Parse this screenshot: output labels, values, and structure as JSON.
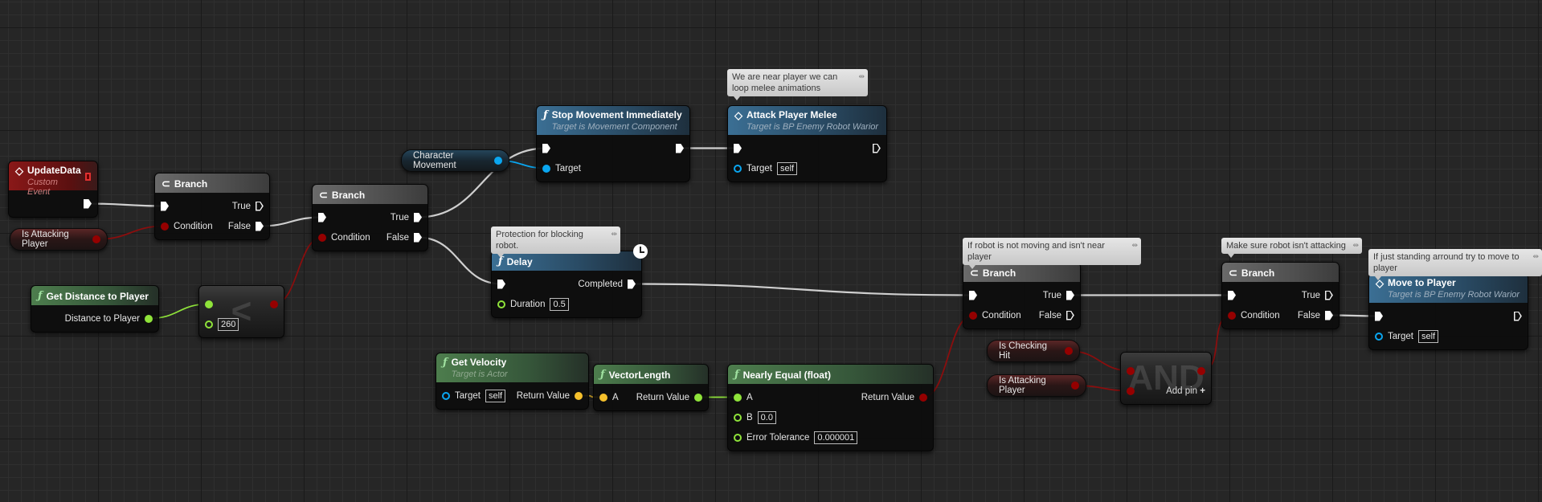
{
  "colors": {
    "exec": "#ffffff",
    "bool": "#950000",
    "float": "#8fe33a",
    "object": "#0aa6f0",
    "vector": "#f5c02c"
  },
  "nodes": [
    {
      "id": "update_data",
      "type": "event",
      "icon": "event-diamond-icon",
      "title": "UpdateData",
      "subtitle": "Custom Event",
      "inputs": [],
      "outputs": [
        {
          "kind": "exec",
          "label": ""
        }
      ]
    },
    {
      "id": "branch1",
      "type": "branch",
      "icon": "branch-icon",
      "title": "Branch",
      "inputs": [
        {
          "kind": "exec",
          "label": ""
        },
        {
          "kind": "bool",
          "label": "Condition"
        }
      ],
      "outputs": [
        {
          "kind": "exec",
          "label": "True",
          "hollow": true
        },
        {
          "kind": "exec",
          "label": "False"
        }
      ]
    },
    {
      "id": "is_attacking_1",
      "type": "var",
      "vartype": "bool",
      "title": "Is Attacking Player"
    },
    {
      "id": "get_distance",
      "type": "pure",
      "icon": "function-icon",
      "title": "Get Distance to Player",
      "inputs": [],
      "outputs": [
        {
          "kind": "float",
          "label": "Distance to Player"
        }
      ]
    },
    {
      "id": "compare",
      "type": "op",
      "symbol": "<",
      "inputs": [
        {
          "kind": "float",
          "label": ""
        },
        {
          "kind": "float",
          "label": "",
          "value": "260",
          "hollow": true
        }
      ],
      "outputs": [
        {
          "kind": "bool",
          "label": ""
        }
      ]
    },
    {
      "id": "branch2",
      "type": "branch",
      "icon": "branch-icon",
      "title": "Branch",
      "inputs": [
        {
          "kind": "exec",
          "label": ""
        },
        {
          "kind": "bool",
          "label": "Condition"
        }
      ],
      "outputs": [
        {
          "kind": "exec",
          "label": "True"
        },
        {
          "kind": "exec",
          "label": "False"
        }
      ]
    },
    {
      "id": "char_movement",
      "type": "var",
      "vartype": "object",
      "title": "Character Movement"
    },
    {
      "id": "stop_movement",
      "type": "function",
      "icon": "function-icon",
      "title": "Stop Movement Immediately",
      "subtitle": "Target is Movement Component",
      "inputs": [
        {
          "kind": "exec",
          "label": ""
        },
        {
          "kind": "object",
          "label": "Target"
        }
      ],
      "outputs": [
        {
          "kind": "exec",
          "label": ""
        }
      ]
    },
    {
      "id": "attack_melee",
      "type": "function",
      "icon": "event-diamond-icon",
      "title": "Attack Player Melee",
      "subtitle": "Target is BP Enemy Robot Warior",
      "inputs": [
        {
          "kind": "exec",
          "label": ""
        },
        {
          "kind": "object",
          "label": "Target",
          "value": "self",
          "hollow": true
        }
      ],
      "outputs": [
        {
          "kind": "exec",
          "label": "",
          "hollow": true
        }
      ]
    },
    {
      "id": "delay",
      "type": "function",
      "icon": "function-icon",
      "title": "Delay",
      "latent": true,
      "inputs": [
        {
          "kind": "exec",
          "label": ""
        },
        {
          "kind": "float",
          "label": "Duration",
          "value": "0.5",
          "hollow": true
        }
      ],
      "outputs": [
        {
          "kind": "exec",
          "label": "Completed"
        }
      ]
    },
    {
      "id": "branch3",
      "type": "branch",
      "icon": "branch-icon",
      "title": "Branch",
      "inputs": [
        {
          "kind": "exec",
          "label": ""
        },
        {
          "kind": "bool",
          "label": "Condition"
        }
      ],
      "outputs": [
        {
          "kind": "exec",
          "label": "True"
        },
        {
          "kind": "exec",
          "label": "False",
          "hollow": true
        }
      ]
    },
    {
      "id": "branch4",
      "type": "branch",
      "icon": "branch-icon",
      "title": "Branch",
      "inputs": [
        {
          "kind": "exec",
          "label": ""
        },
        {
          "kind": "bool",
          "label": "Condition"
        }
      ],
      "outputs": [
        {
          "kind": "exec",
          "label": "True",
          "hollow": true
        },
        {
          "kind": "exec",
          "label": "False"
        }
      ]
    },
    {
      "id": "move_to_player",
      "type": "function",
      "icon": "event-diamond-icon",
      "title": "Move to Player",
      "subtitle": "Target is BP Enemy Robot Warior",
      "inputs": [
        {
          "kind": "exec",
          "label": ""
        },
        {
          "kind": "object",
          "label": "Target",
          "value": "self",
          "hollow": true
        }
      ],
      "outputs": [
        {
          "kind": "exec",
          "label": "",
          "hollow": true
        }
      ]
    },
    {
      "id": "is_checking_hit",
      "type": "var",
      "vartype": "bool",
      "title": "Is Checking Hit"
    },
    {
      "id": "is_attacking_2",
      "type": "var",
      "vartype": "bool",
      "title": "Is Attacking Player"
    },
    {
      "id": "and",
      "type": "op",
      "symbol": "AND",
      "add_pin": "Add pin",
      "inputs": [
        {
          "kind": "bool",
          "label": ""
        },
        {
          "kind": "bool",
          "label": ""
        }
      ],
      "outputs": [
        {
          "kind": "bool",
          "label": ""
        }
      ]
    },
    {
      "id": "get_velocity",
      "type": "pure",
      "icon": "function-icon",
      "title": "Get Velocity",
      "subtitle": "Target is Actor",
      "inputs": [
        {
          "kind": "object",
          "label": "Target",
          "value": "self",
          "hollow": true
        }
      ],
      "outputs": [
        {
          "kind": "vector",
          "label": "Return Value"
        }
      ]
    },
    {
      "id": "vector_length",
      "type": "pure",
      "icon": "function-icon",
      "title": "VectorLength",
      "inputs": [
        {
          "kind": "vector",
          "label": "A"
        }
      ],
      "outputs": [
        {
          "kind": "float",
          "label": "Return Value"
        }
      ]
    },
    {
      "id": "nearly_equal",
      "type": "pure",
      "icon": "function-icon",
      "title": "Nearly Equal (float)",
      "inputs": [
        {
          "kind": "float",
          "label": "A"
        },
        {
          "kind": "float",
          "label": "B",
          "value": "0.0",
          "hollow": true
        },
        {
          "kind": "float",
          "label": "Error Tolerance",
          "value": "0.000001",
          "hollow": true
        }
      ],
      "outputs": [
        {
          "kind": "bool",
          "label": "Return Value"
        }
      ]
    }
  ],
  "comments": [
    {
      "id": "c_melee",
      "text": "We are near player we can loop melee animations"
    },
    {
      "id": "c_protection",
      "text": "Protection for blocking robot."
    },
    {
      "id": "c_not_moving",
      "text": "If robot is not moving and isn't near player"
    },
    {
      "id": "c_not_attacking",
      "text": "Make sure robot isn't attacking"
    },
    {
      "id": "c_move",
      "text": "If just standing arround try to move to player"
    }
  ],
  "links": [
    [
      "update_data",
      "o0",
      "branch1",
      "i0",
      "exec"
    ],
    [
      "is_attacking_1",
      "o0",
      "branch1",
      "i1",
      "bool"
    ],
    [
      "branch1",
      "o1",
      "branch2",
      "i0",
      "exec"
    ],
    [
      "get_distance",
      "o0",
      "compare",
      "i0",
      "float"
    ],
    [
      "compare",
      "o0",
      "branch2",
      "i1",
      "bool"
    ],
    [
      "branch2",
      "o0",
      "stop_movement",
      "i0",
      "exec"
    ],
    [
      "char_movement",
      "o0",
      "stop_movement",
      "i1",
      "object"
    ],
    [
      "stop_movement",
      "o0",
      "attack_melee",
      "i0",
      "exec"
    ],
    [
      "branch2",
      "o1",
      "delay",
      "i0",
      "exec"
    ],
    [
      "delay",
      "o0",
      "branch3",
      "i0",
      "exec"
    ],
    [
      "get_velocity",
      "o0",
      "vector_length",
      "i0",
      "vector"
    ],
    [
      "vector_length",
      "o0",
      "nearly_equal",
      "i0",
      "float"
    ],
    [
      "nearly_equal",
      "o0",
      "branch3",
      "i1",
      "bool"
    ],
    [
      "branch3",
      "o0",
      "branch4",
      "i0",
      "exec"
    ],
    [
      "is_checking_hit",
      "o0",
      "and",
      "i0",
      "bool"
    ],
    [
      "is_attacking_2",
      "o0",
      "and",
      "i1",
      "bool"
    ],
    [
      "and",
      "o0",
      "branch4",
      "i1",
      "bool"
    ],
    [
      "branch4",
      "o1",
      "move_to_player",
      "i0",
      "exec"
    ]
  ]
}
